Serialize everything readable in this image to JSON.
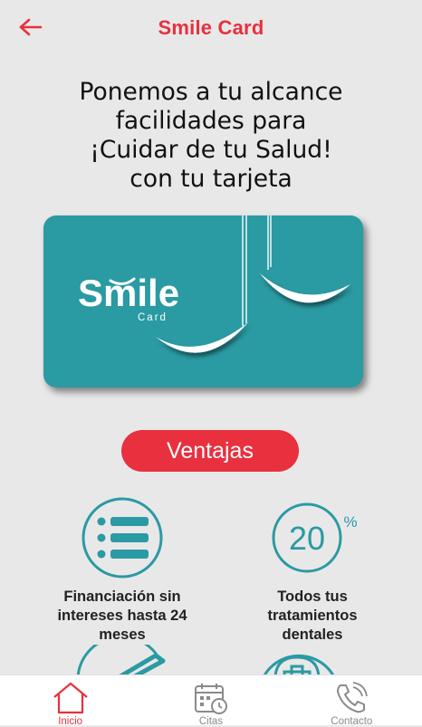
{
  "header": {
    "title": "Smile Card",
    "back_icon": "arrow-left-icon"
  },
  "intro": {
    "lines": [
      "Ponemos a tu alcance",
      "facilidades para",
      "¡Cuidar de tu Salud!",
      "con tu tarjeta"
    ]
  },
  "card": {
    "brand": "Smile",
    "sub": "Card",
    "color": "#2a9aa3"
  },
  "ventajas_button": "Ventajas",
  "features": [
    {
      "icon": "list-icon",
      "text_lines": [
        "Financiación sin",
        "intereses hasta 24",
        "meses"
      ]
    },
    {
      "icon": "percent-20-icon",
      "number": "20",
      "symbol": "%",
      "text_lines": [
        "Todos tus",
        "tratamientos",
        "dentales"
      ]
    }
  ],
  "tabs": [
    {
      "label": "Inicio",
      "icon": "home-icon",
      "active": true
    },
    {
      "label": "Citas",
      "icon": "calendar-clock-icon",
      "active": false
    },
    {
      "label": "Contacto",
      "icon": "phone-icon",
      "active": false
    }
  ],
  "colors": {
    "accent": "#e8303e",
    "teal": "#2a9aa3",
    "background": "#e9e8e8"
  }
}
